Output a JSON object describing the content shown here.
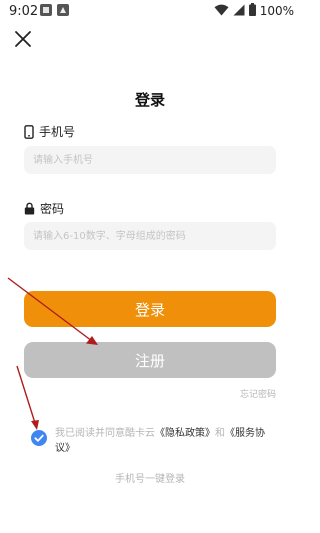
{
  "status_bar": {
    "time": "9:02",
    "battery": "100%",
    "icons": [
      "app-notification-icon",
      "app-notification-icon",
      "wifi-icon",
      "signal-icon",
      "battery-icon"
    ]
  },
  "header": {
    "close_icon": "close-icon"
  },
  "page": {
    "title": "登录"
  },
  "phone": {
    "label": "手机号",
    "icon": "phone-icon",
    "placeholder": "请输入手机号",
    "value": ""
  },
  "password": {
    "label": "密码",
    "icon": "lock-icon",
    "placeholder": "请输入6-10数字、字母组成的密码",
    "value": ""
  },
  "buttons": {
    "login": "登录",
    "register": "注册",
    "forgot": "忘记密码"
  },
  "agreement": {
    "checked": true,
    "prefix": "我已阅读并同意酷卡云",
    "privacy": "《隐私政策》",
    "and": "和",
    "service": "《服务协议》"
  },
  "one_tap_login": "手机号一键登录",
  "colors": {
    "accent_orange": "#f0900a",
    "register_gray": "#c0c0c0",
    "checkbox_blue": "#3f86f3",
    "input_bg": "#f4f4f4",
    "annotation_arrow": "#b01c1c"
  }
}
